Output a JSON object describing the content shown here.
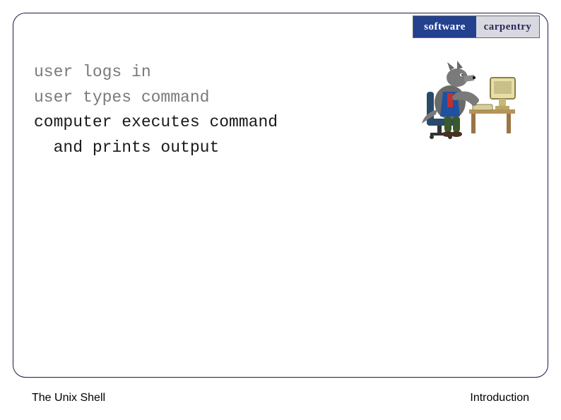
{
  "logo": {
    "left": "software",
    "right": "carpentry"
  },
  "lines": {
    "l1": "user logs in",
    "l2": "user types command",
    "l3": "computer executes command",
    "l4": "  and prints output"
  },
  "footer": {
    "left": "The Unix Shell",
    "right": "Introduction"
  },
  "illustration": {
    "name": "wolf-at-computer"
  }
}
